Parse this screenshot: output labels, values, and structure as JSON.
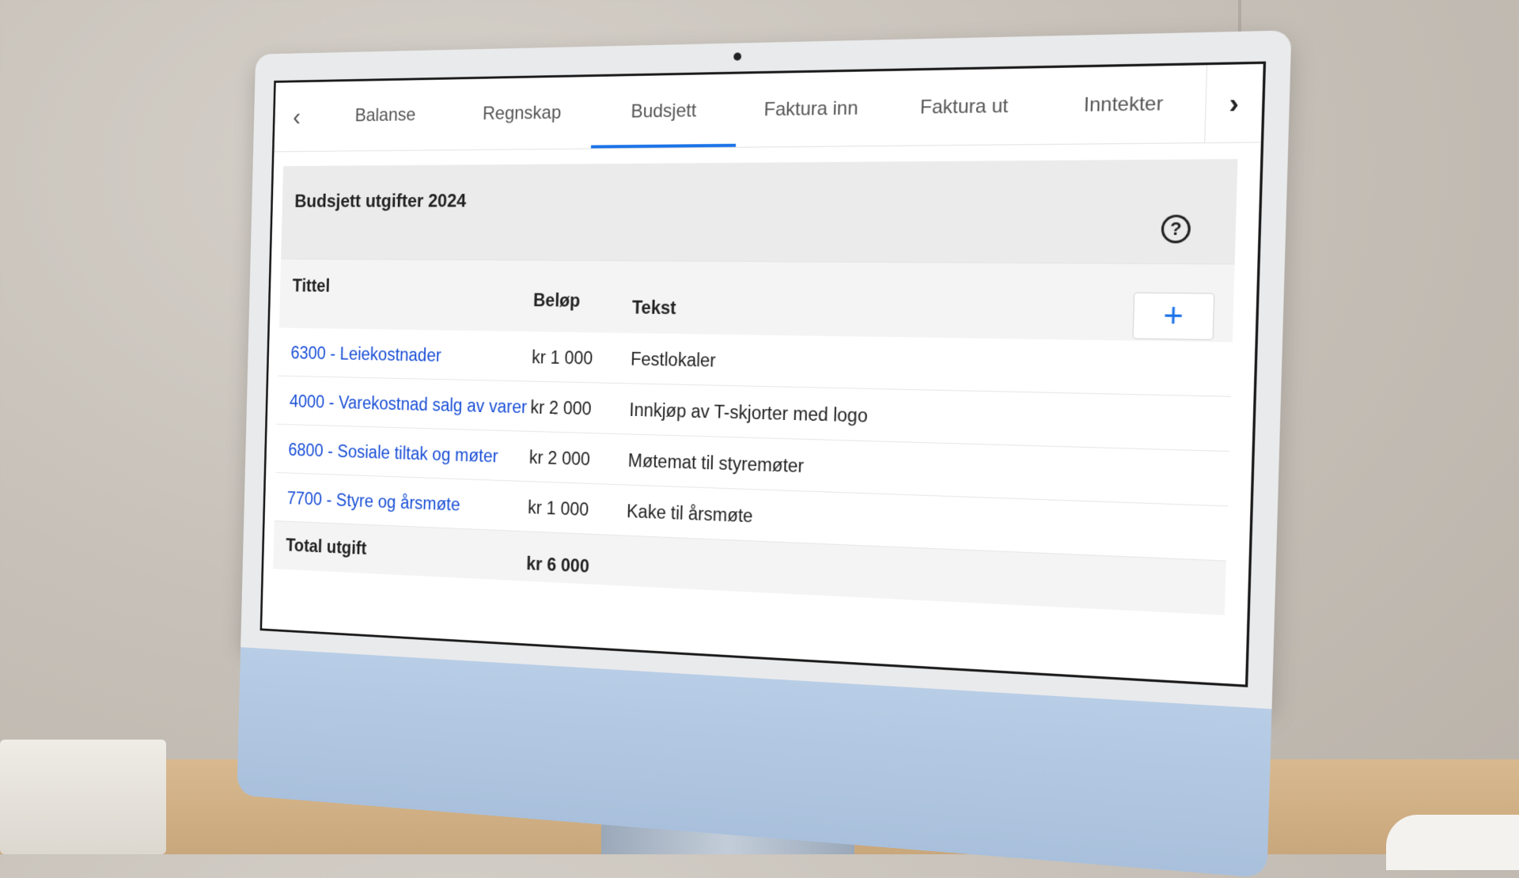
{
  "tabs": {
    "prev_icon": "chevron-left-icon",
    "next_icon": "chevron-right-icon",
    "items": [
      {
        "label": "Balanse"
      },
      {
        "label": "Regnskap"
      },
      {
        "label": "Budsjett",
        "active": true
      },
      {
        "label": "Faktura inn"
      },
      {
        "label": "Faktura ut"
      },
      {
        "label": "Inntekter"
      }
    ]
  },
  "budget": {
    "title": "Budsjett utgifter 2024",
    "help_icon": "question-circle-icon",
    "add_icon": "plus-icon",
    "columns": {
      "title": "Tittel",
      "amount": "Beløp",
      "text": "Tekst"
    },
    "rows": [
      {
        "title": "6300 - Leiekostnader",
        "amount": "kr 1 000",
        "text": "Festlokaler"
      },
      {
        "title": "4000 - Varekostnad salg av varer",
        "amount": "kr 2 000",
        "text": "Innkjøp av T-skjorter med logo"
      },
      {
        "title": "6800 - Sosiale tiltak og møter",
        "amount": "kr 2 000",
        "text": "Møtemat til styremøter"
      },
      {
        "title": "7700 - Styre og årsmøte",
        "amount": "kr 1 000",
        "text": "Kake til årsmøte"
      }
    ],
    "total": {
      "label": "Total utgift",
      "amount": "kr 6 000"
    }
  },
  "colors": {
    "accent": "#1a73e8",
    "link": "#1a4fd6"
  }
}
